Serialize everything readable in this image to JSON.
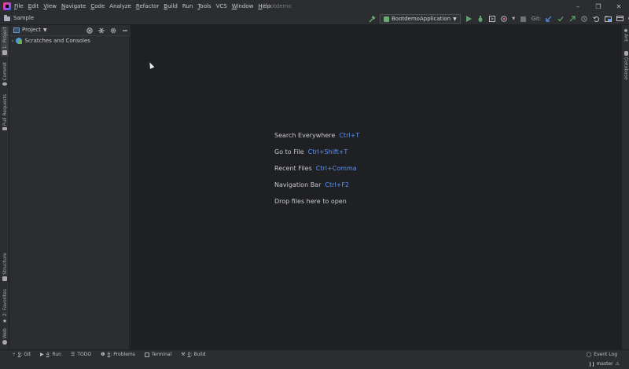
{
  "titlebar": {
    "menu": [
      {
        "u": "F",
        "rest": "ile"
      },
      {
        "u": "E",
        "rest": "dit"
      },
      {
        "u": "V",
        "rest": "iew"
      },
      {
        "u": "N",
        "rest": "avigate"
      },
      {
        "u": "C",
        "rest": "ode"
      },
      {
        "u": "",
        "rest": "Analyze"
      },
      {
        "u": "R",
        "rest": "efactor"
      },
      {
        "u": "B",
        "rest": "uild"
      },
      {
        "u": "",
        "rest": "Run"
      },
      {
        "u": "T",
        "rest": "ools"
      },
      {
        "u": "",
        "rest": "VCS"
      },
      {
        "u": "W",
        "rest": "indow"
      },
      {
        "u": "H",
        "rest": "elp"
      }
    ],
    "project_name": "bootdemo",
    "window_controls": {
      "minimize": "–",
      "restore": "❐",
      "close": "✕"
    }
  },
  "navbar": {
    "breadcrumb": "Sample",
    "run_config": "BootdemoApplication",
    "git_label": "Git:"
  },
  "left_strip": {
    "tabs": [
      "1: Project",
      "Commit",
      "Pull Requests",
      "Structure",
      "2: Favorites",
      "Web"
    ]
  },
  "right_strip": {
    "tabs": [
      "Ant",
      "Database"
    ]
  },
  "project_panel": {
    "title": "Project",
    "tree": [
      {
        "label": "Scratches and Consoles"
      }
    ]
  },
  "editor": {
    "hints": [
      {
        "label": "Search Everywhere",
        "shortcut": "Ctrl+T"
      },
      {
        "label": "Go to File",
        "shortcut": "Ctrl+Shift+T"
      },
      {
        "label": "Recent Files",
        "shortcut": "Ctrl+Comma"
      },
      {
        "label": "Navigation Bar",
        "shortcut": "Ctrl+F2"
      },
      {
        "label": "Drop files here to open",
        "shortcut": ""
      }
    ]
  },
  "bottom_bar": {
    "tabs": [
      {
        "num": "9",
        "label": ": Git",
        "icon": "git-branch-icon"
      },
      {
        "num": "4",
        "label": ": Run",
        "icon": "run-icon"
      },
      {
        "num": "",
        "label": "TODO",
        "icon": "todo-list-icon"
      },
      {
        "num": "6",
        "label": ": Problems",
        "icon": "problems-icon"
      },
      {
        "num": "",
        "label": "Terminal",
        "icon": "terminal-icon"
      },
      {
        "num": "0",
        "label": ": Build",
        "icon": "build-hammer-icon"
      }
    ],
    "event_log": "Event Log"
  },
  "status_bar": {
    "branch": "master"
  },
  "colors": {
    "accent_blue": "#5c93f0",
    "run_green": "#6aab73",
    "editor_bg": "#1f2023",
    "chrome_bg": "#2b2d30"
  }
}
